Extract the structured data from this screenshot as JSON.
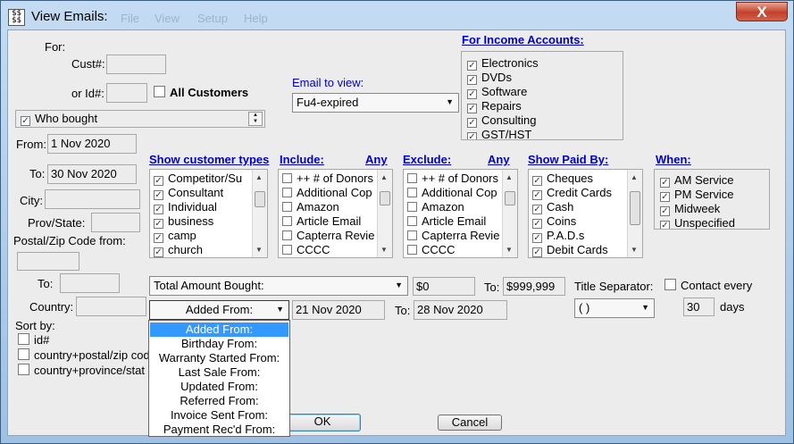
{
  "window": {
    "title": "View Emails:",
    "app_icon_text": "$$\n$$",
    "ghost_menu": [
      "File",
      "View",
      "Setup",
      "Help"
    ],
    "close_label": "X"
  },
  "labels": {
    "for": "For:",
    "cust": "Cust#:",
    "id": "or Id#:",
    "all_customers": "All Customers",
    "from": "From:",
    "to": "To:",
    "city": "City:",
    "prov": "Prov/State:",
    "postal_from": "Postal/Zip Code from:",
    "postal_to": "To:",
    "country": "Country:",
    "sort_by": "Sort by:",
    "email_to_view": "Email to view:",
    "to2": "To:",
    "to3": "To:",
    "title_sep": "Title Separator:",
    "contact_every": "Contact every",
    "days": "days"
  },
  "fields": {
    "cust": "",
    "id": "",
    "who": "Who bought",
    "from_date": "1 Nov 2020",
    "to_date": "30 Nov 2020",
    "city": "",
    "prov": "",
    "postal_from": "",
    "postal_to": "",
    "country": "",
    "amount_min": "$0",
    "amount_max": "$999,999",
    "date_from": "21 Nov 2020",
    "date_to": "28 Nov 2020",
    "contact_days": "30",
    "email_view": "Fu4-expired",
    "amount_field": "Total Amount Bought:",
    "date_field": "Added From:",
    "title_sep_value": "( )"
  },
  "income": {
    "header": "For Income Accounts:",
    "items": [
      "Electronics",
      "DVDs",
      "Software",
      "Repairs",
      "Consulting",
      "GST/HST"
    ]
  },
  "types": {
    "header": "Show customer types",
    "items": [
      "Competitor/Su",
      "Consultant",
      "Individual",
      "business",
      "camp",
      "church"
    ]
  },
  "include": {
    "header": "Include:",
    "any": "Any",
    "items": [
      "++ # of Donors",
      "Additional Cop",
      "Amazon",
      "Article Email",
      "Capterra Revie",
      "CCCC"
    ]
  },
  "exclude": {
    "header": "Exclude:",
    "any": "Any",
    "items": [
      "++ # of Donors",
      "Additional Cop",
      "Amazon",
      "Article Email",
      "Capterra Revie",
      "CCCC"
    ]
  },
  "paid": {
    "header": "Show Paid By:",
    "items": [
      "Cheques",
      "Credit Cards",
      "Cash",
      "Coins",
      "P.A.D.s",
      "Debit Cards"
    ]
  },
  "when": {
    "header": "When:",
    "items": [
      "AM Service",
      "PM Service",
      "Midweek",
      "Unspecified"
    ]
  },
  "sort": [
    "id#",
    "country+postal/zip cod",
    "country+province/stat"
  ],
  "dropdown": [
    "Added From:",
    "Birthday From:",
    "Warranty Started From:",
    "Last Sale From:",
    "Updated From:",
    "Referred From:",
    "Invoice Sent From:",
    "Payment Rec'd From:"
  ],
  "buttons": {
    "ok": "OK",
    "cancel": "Cancel"
  },
  "glyphs": {
    "check": "✓",
    "down": "▼",
    "up": "▲",
    "spin_up": "▲",
    "spin_down": "▼"
  }
}
